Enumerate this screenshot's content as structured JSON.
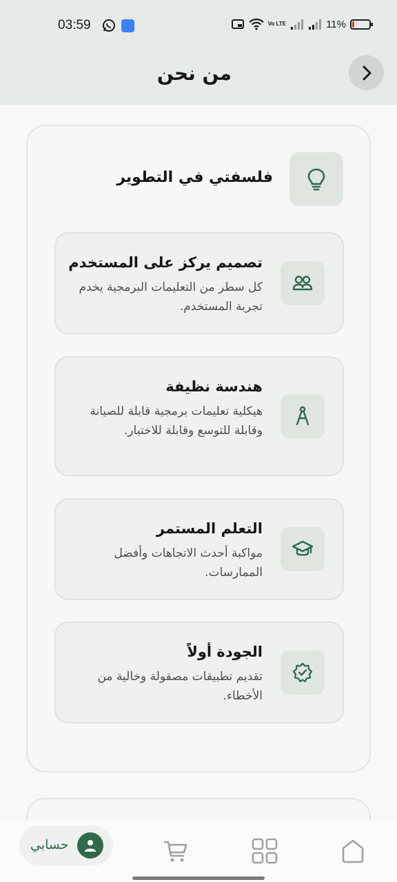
{
  "status_bar": {
    "time": "03:59",
    "battery_percent": "11%",
    "battery_level": 0.11,
    "network_label": "Vo LTE"
  },
  "app_bar": {
    "title": "من نحن",
    "back_icon": "chevron-right-icon"
  },
  "philosophy": {
    "title": "فلسفتي في التطوير",
    "icon": "lightbulb-icon",
    "items": [
      {
        "title": "تصميم يركز على المستخدم",
        "description": "كل سطر من التعليمات البرمجية يخدم تجربة المستخدم.",
        "icon": "users-icon"
      },
      {
        "title": "هندسة نظيفة",
        "description": "هيكلية تعليمات برمجية قابلة للصيانة وقابلة للتوسع وقابلة للاختبار.",
        "icon": "compass-icon"
      },
      {
        "title": "التعلم المستمر",
        "description": "مواكبة أحدث الاتجاهات وأفضل الممارسات.",
        "icon": "graduation-cap-icon"
      },
      {
        "title": "الجودة أولاً",
        "description": "تقديم تطبيقات مصقولة وخالية من الأخطاء.",
        "icon": "verified-badge-icon"
      }
    ]
  },
  "bottom_nav": {
    "account_label": "حسابي",
    "items": [
      "account",
      "cart",
      "apps",
      "home"
    ]
  },
  "colors": {
    "accent": "#2f6b48",
    "header_bg": "#e6ebe7",
    "card_bg": "#eff1ef"
  }
}
